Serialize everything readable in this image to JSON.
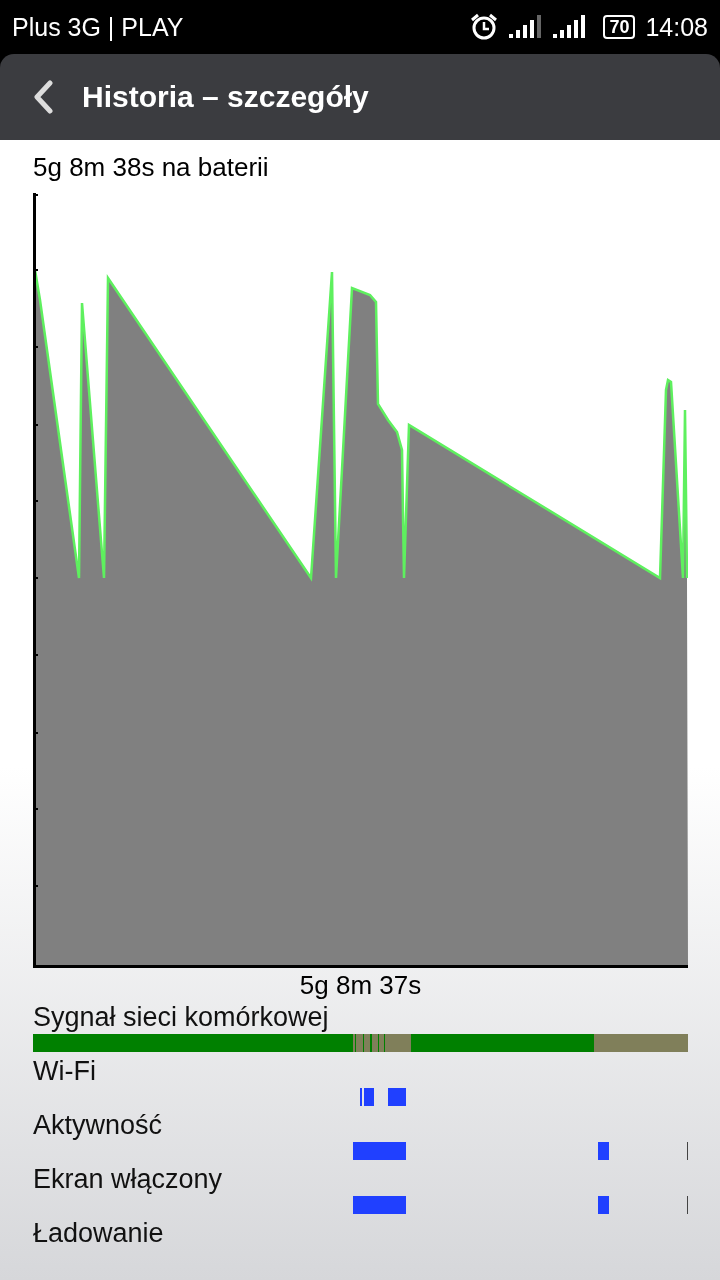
{
  "status_bar": {
    "carrier": "Plus 3G | PLAY",
    "battery": "70",
    "time": "14:08"
  },
  "header": {
    "title": "Historia – szczegóły"
  },
  "graph": {
    "title": "5g 8m 38s na baterii",
    "duration": "5g 8m 37s"
  },
  "timelines": [
    {
      "label": "Sygnał sieci komórkowej",
      "kind": "signal"
    },
    {
      "label": "Wi-Fi",
      "kind": "wifi"
    },
    {
      "label": "Aktywność",
      "kind": "awake"
    },
    {
      "label": "Ekran włączony",
      "kind": "screen"
    },
    {
      "label": "Ładowanie",
      "kind": "charging"
    }
  ]
}
